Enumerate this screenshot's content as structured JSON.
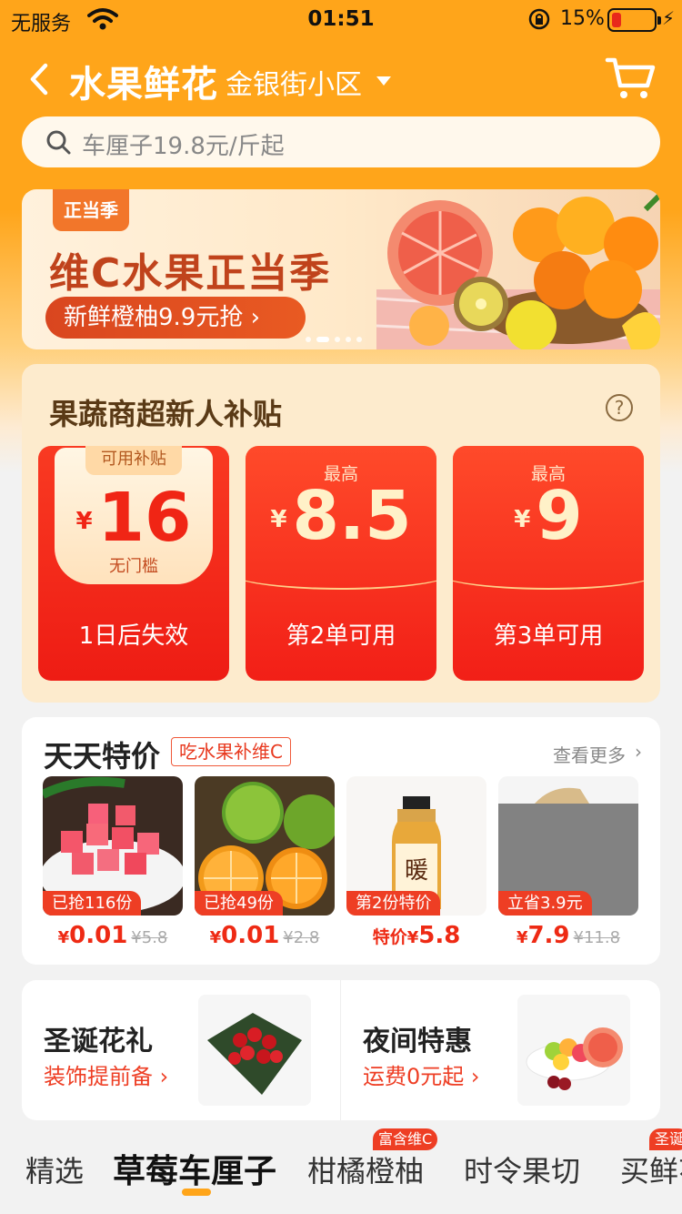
{
  "status_bar": {
    "carrier": "无服务",
    "time": "01:51",
    "battery_pct": "15%"
  },
  "header": {
    "title": "水果鲜花",
    "community": "金银街小区"
  },
  "search": {
    "placeholder": "车厘子19.8元/斤起"
  },
  "banner": {
    "badge": "正当季",
    "headline": "维C水果正当季",
    "sub": "新鲜橙柚9.9元抢 ›",
    "slides": 5,
    "active_slide": 1
  },
  "subsidy": {
    "title": "果蔬商超新人补贴",
    "help": "?",
    "coupons": [
      {
        "tag": "可用补贴",
        "yen": "¥",
        "amount": "16",
        "note": "无门槛",
        "condition": "1日后失效"
      },
      {
        "top": "最高",
        "yen": "¥",
        "amount": "8.5",
        "condition": "第2单可用"
      },
      {
        "top": "最高",
        "yen": "¥",
        "amount": "9",
        "condition": "第3单可用"
      }
    ]
  },
  "deals": {
    "title": "天天特价",
    "tagline": "吃水果补维C",
    "more": "查看更多",
    "products": [
      {
        "label": "已抢116份",
        "yen": "¥",
        "price": "0.01",
        "orig": "¥5.8"
      },
      {
        "label": "已抢49份",
        "yen": "¥",
        "price": "0.01",
        "orig": "¥2.8"
      },
      {
        "label": "第2份特价",
        "prefix": "特价",
        "yen": "¥",
        "price": "5.8"
      },
      {
        "label": "立省3.9元",
        "yen": "¥",
        "price": "7.9",
        "orig": "¥11.8"
      }
    ]
  },
  "promos": [
    {
      "title": "圣诞花礼",
      "sub": "装饰提前备 ›"
    },
    {
      "title": "夜间特惠",
      "sub": "运费0元起 ›"
    }
  ],
  "categories": [
    {
      "label": "精选"
    },
    {
      "label": "草莓车厘子",
      "active": true
    },
    {
      "label": "柑橘橙柚",
      "bubble": "富含维C"
    },
    {
      "label": "时令果切"
    },
    {
      "label": "买鲜花",
      "bubble": "圣诞"
    }
  ],
  "colors": {
    "brand_orange": "#ffa51a",
    "coupon_red": "#f21f17",
    "price_red": "#ee2a14"
  }
}
